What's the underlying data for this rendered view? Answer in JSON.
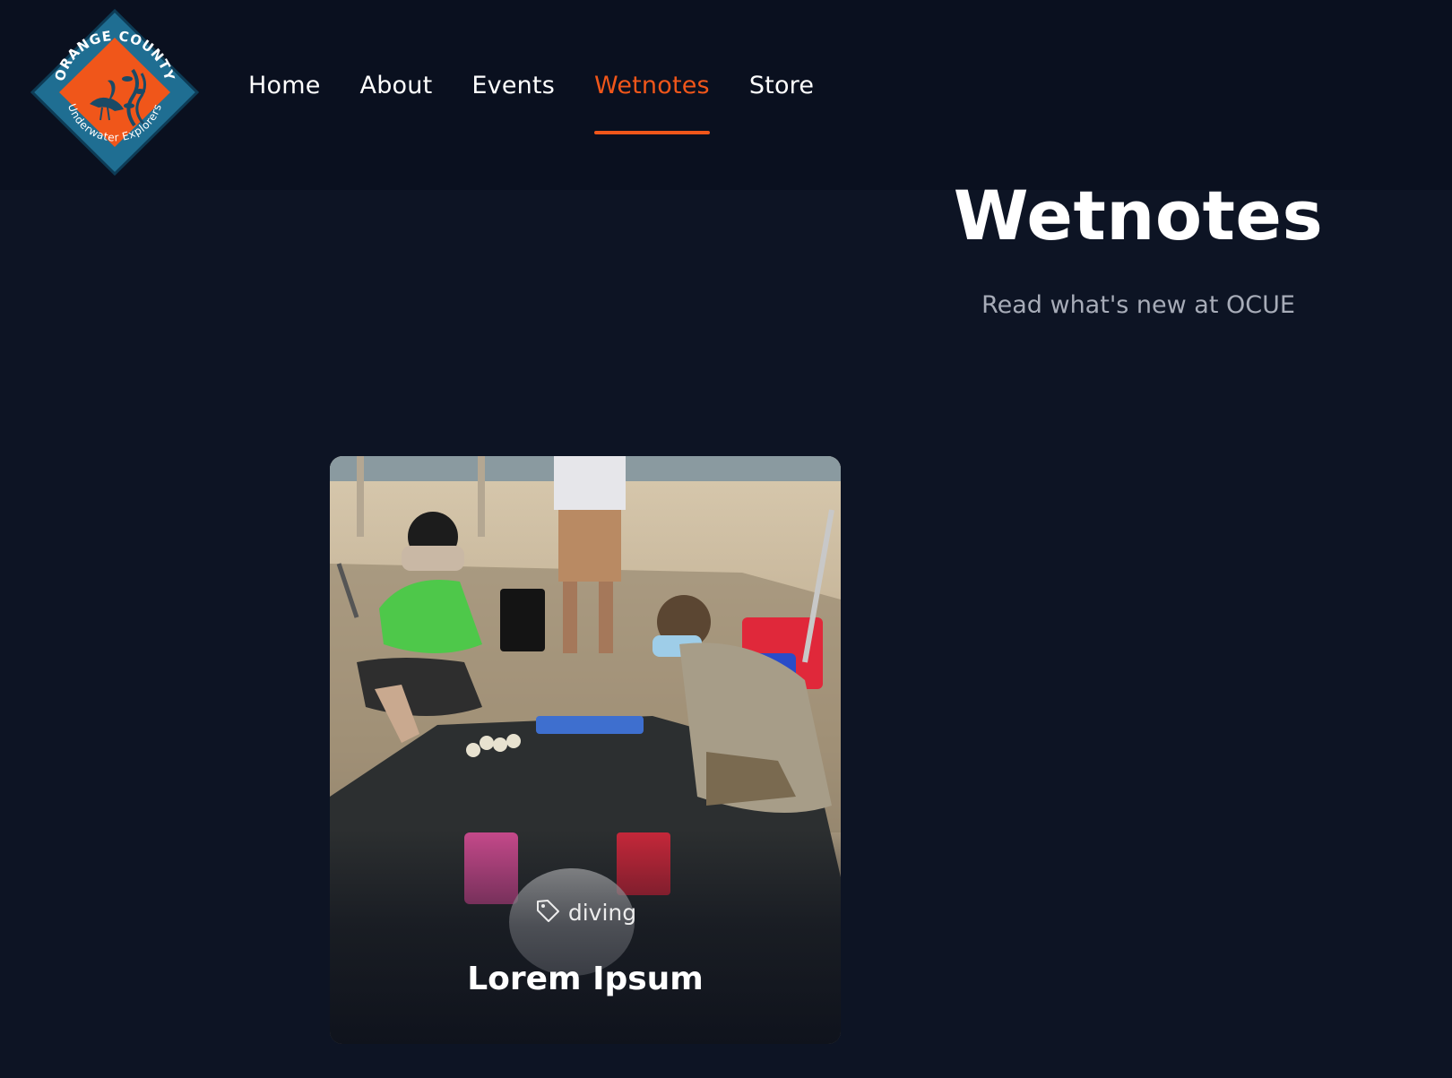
{
  "brand": {
    "logo_text_top": "ORANGE COUNTY",
    "logo_text_bottom": "Underwater Explorers",
    "logo_colors": {
      "outer": "#1f6e92",
      "inner": "#f0561a"
    }
  },
  "nav": {
    "items": [
      {
        "label": "Home",
        "active": false
      },
      {
        "label": "About",
        "active": false
      },
      {
        "label": "Events",
        "active": false
      },
      {
        "label": "Wetnotes",
        "active": true
      },
      {
        "label": "Store",
        "active": false
      }
    ],
    "accent_color": "#f0561a"
  },
  "hero": {
    "title": "Wetnotes",
    "subtitle": "Read what's new at OCUE"
  },
  "posts": [
    {
      "tag": "diving",
      "tag_icon": "tag-icon",
      "title": "Lorem Ipsum"
    }
  ],
  "colors": {
    "page_bg": "#0d1424",
    "header_bg": "#0a101f",
    "subtitle": "#a7acb8"
  }
}
